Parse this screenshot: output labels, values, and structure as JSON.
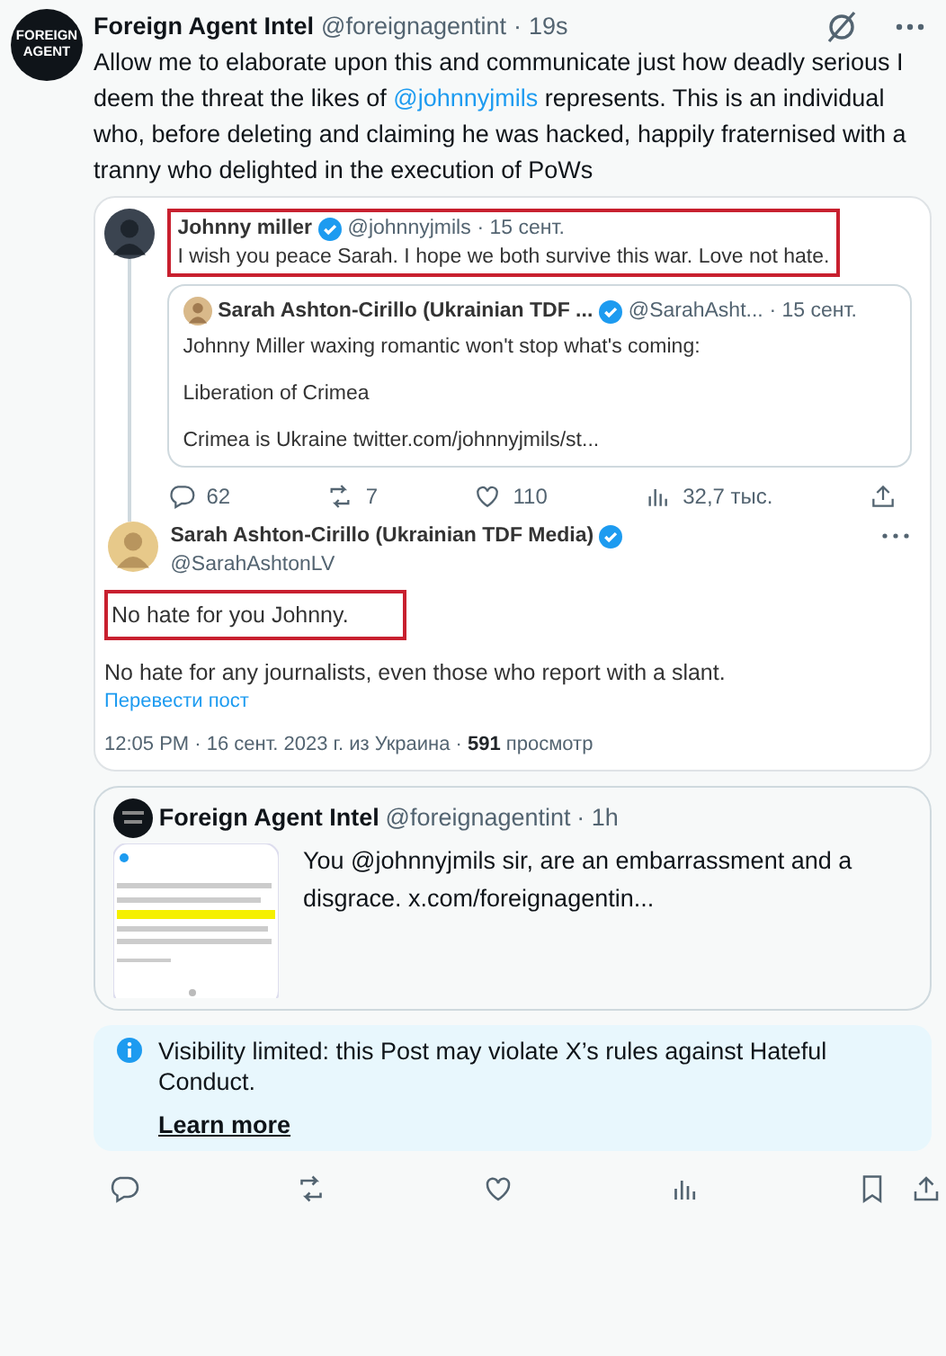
{
  "post": {
    "avatar_text": [
      "FOREIGN",
      "AGENT"
    ],
    "name": "Foreign Agent Intel",
    "handle": "@foreignagentint",
    "separator": "·",
    "time": "19s",
    "body": [
      {
        "kind": "text",
        "text": "Allow me to elaborate upon this and communicate just how deadly serious I deem the threat the likes of "
      },
      {
        "kind": "mention",
        "text": "@johnnyjmils"
      },
      {
        "kind": "text",
        "text": " represents. This is an individual who, before deleting and claiming he was hacked, happily fraternised with a tranny who delighted in the execution of PoWs"
      }
    ]
  },
  "screenshot": {
    "reply": {
      "name": "Johnny miller",
      "verified": true,
      "handle": "@johnnyjmils",
      "time": "· 15 сент.",
      "text": "I wish you peace Sarah. I hope we both survive this war. Love not hate.",
      "highlighted": true
    },
    "quoted": {
      "name": "Sarah Ashton-Cirillo (Ukrainian TDF ...",
      "verified": true,
      "handle": "@SarahAsht...",
      "time": "· 15 сент.",
      "lines": [
        "Johnny Miller waxing romantic won't stop what's coming:",
        "Liberation of Crimea",
        "Crimea is Ukraine twitter.com/johnnyjmils/st..."
      ]
    },
    "actions": [
      {
        "kind": "reply",
        "count": "62"
      },
      {
        "kind": "repost",
        "count": "7"
      },
      {
        "kind": "like",
        "count": "110"
      },
      {
        "kind": "views",
        "count": "32,7 тыс."
      },
      {
        "kind": "share"
      }
    ],
    "main": {
      "name": "Sarah Ashton-Cirillo (Ukrainian TDF Media)",
      "verified": true,
      "handle": "@SarahAshtonLV",
      "highlighted_text": "No hate for you Johnny.",
      "highlighted": true,
      "text": "No hate for any journalists, even those who report with a slant.",
      "translate": "Перевести пост",
      "meta": "12:05 PM · 16 сент. 2023 г. из Украина · ",
      "views": "591",
      "views_label": "просмотр"
    }
  },
  "quote": {
    "name": "Foreign Agent Intel",
    "handle": "@foreignagentint",
    "time": "· 1h",
    "text": "You @johnnyjmils sir, are an embarrassment and a disgrace.  x.com/foreignagentin..."
  },
  "notice": {
    "text": "Visibility limited: this Post may violate X’s rules against Hateful Conduct.",
    "link": "Learn more"
  },
  "actions": [
    {
      "kind": "reply"
    },
    {
      "kind": "repost"
    },
    {
      "kind": "like"
    },
    {
      "kind": "views"
    },
    {
      "kind": "bookmark"
    },
    {
      "kind": "share"
    }
  ]
}
